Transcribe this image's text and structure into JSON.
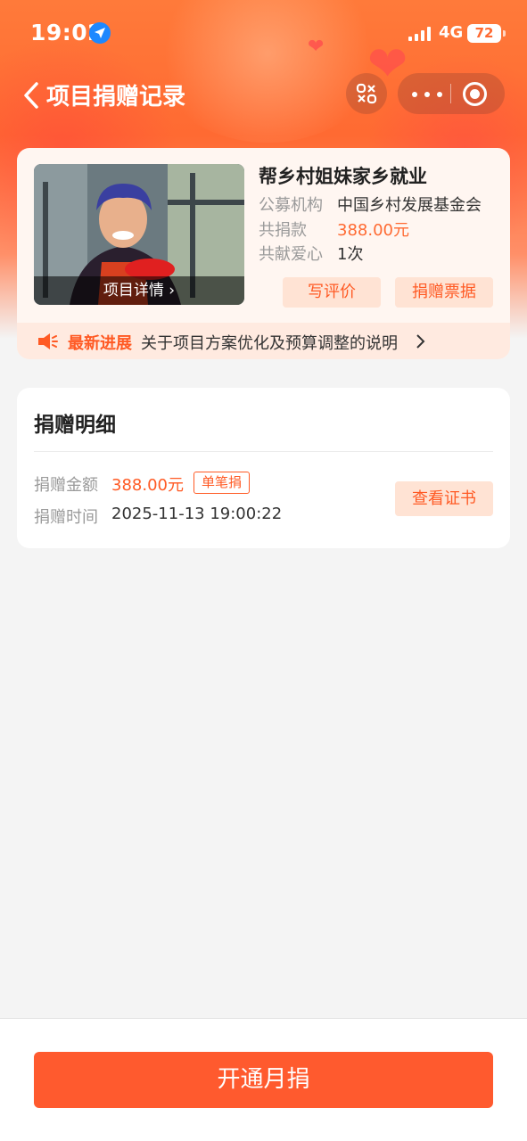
{
  "status_bar": {
    "time": "19:02",
    "network": "4G",
    "battery": "72"
  },
  "nav": {
    "title": "项目捐赠记录"
  },
  "project": {
    "title": "帮乡村姐妹家乡就业",
    "image_caption": "项目详情",
    "rows": [
      {
        "key": "公募机构",
        "value": "中国乡村发展基金会"
      },
      {
        "key": "共捐款",
        "value": "388.00元"
      },
      {
        "key": "共献爱心",
        "value": "1次"
      }
    ],
    "actions": {
      "review": "写评价",
      "receipt": "捐赠票据"
    },
    "news": {
      "tag": "最新进展",
      "text": "关于项目方案优化及预算调整的说明"
    }
  },
  "detail": {
    "title": "捐赠明细",
    "amount_label": "捐赠金额",
    "amount": "388.00元",
    "badge": "单笔捐",
    "time_label": "捐赠时间",
    "time": "2025-11-13 19:00:22",
    "certificate_button": "查看证书"
  },
  "bottom": {
    "button": "开通月捐"
  },
  "colors": {
    "accent": "#ff5a2e",
    "hero": "#ff6a32",
    "light_accent": "#ffe3d4"
  }
}
